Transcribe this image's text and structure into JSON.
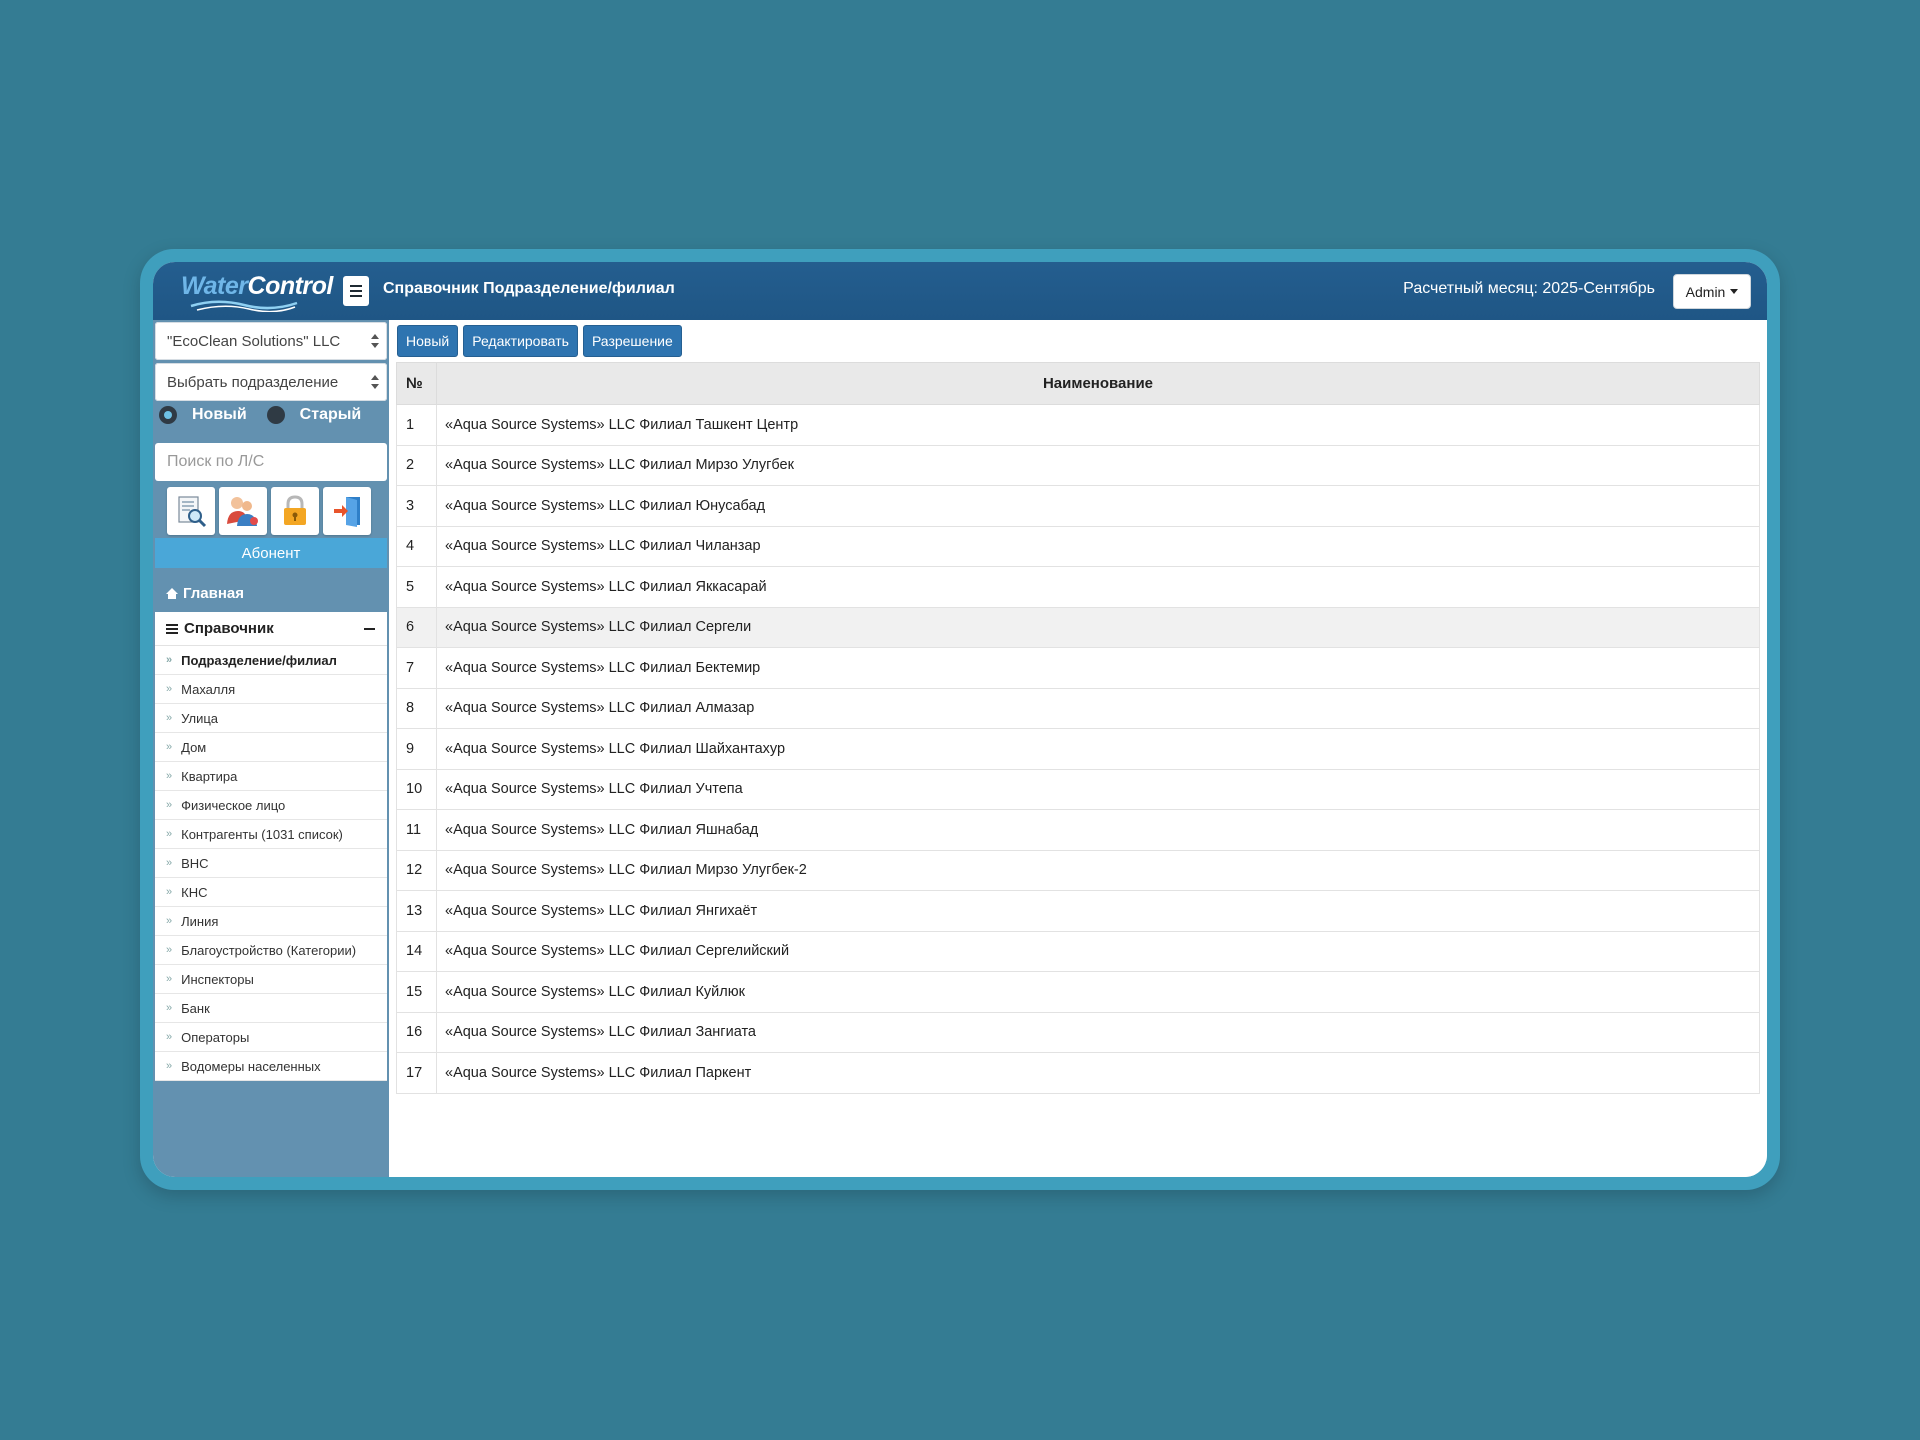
{
  "header": {
    "logo_part1": "Water",
    "logo_part2": "Control",
    "title": "Справочник Подразделение/филиал",
    "month_label": "Расчетный месяц: 2025-Сентябрь",
    "user_menu": "Admin"
  },
  "sidebar": {
    "company_select": "\"EcoClean Solutions\" LLC",
    "division_select": "Выбрать подразделение",
    "radio_new": "Новый",
    "radio_old": "Старый",
    "radio_selected": "Новый",
    "search_placeholder": "Поиск по Л/С",
    "tool_icons": [
      "document-search-icon",
      "users-icon",
      "lock-icon",
      "exit-door-icon"
    ],
    "abonent_label": "Абонент",
    "home_label": "Главная",
    "section_label": "Справочник",
    "items": [
      {
        "label": "Подразделение/филиал",
        "active": true
      },
      {
        "label": "Махалля"
      },
      {
        "label": "Улица"
      },
      {
        "label": "Дом"
      },
      {
        "label": "Квартира"
      },
      {
        "label": "Физическое лицо"
      },
      {
        "label": "Контрагенты (1031 список)"
      },
      {
        "label": "ВНС"
      },
      {
        "label": "КНС"
      },
      {
        "label": "Линия"
      },
      {
        "label": "Благоустройство (Категории)"
      },
      {
        "label": "Инспекторы"
      },
      {
        "label": "Банк"
      },
      {
        "label": "Операторы"
      },
      {
        "label": "Водомеры населенных"
      }
    ],
    "bullet": "»",
    "bottom_icons": [
      "chat-icon",
      "mail-icon"
    ]
  },
  "toolbar": {
    "new_label": "Новый",
    "edit_label": "Редактировать",
    "permission_label": "Разрешение"
  },
  "table": {
    "col_num": "№",
    "col_name": "Наименование",
    "highlighted_row": 6,
    "rows": [
      {
        "num": "1",
        "name": "«Aqua Source Systems» LLC Филиал Ташкент Центр"
      },
      {
        "num": "2",
        "name": "«Aqua Source Systems» LLC Филиал Мирзо Улугбек"
      },
      {
        "num": "3",
        "name": "«Aqua Source Systems» LLC Филиал Юнусабад"
      },
      {
        "num": "4",
        "name": "«Aqua Source Systems» LLC Филиал Чиланзар"
      },
      {
        "num": "5",
        "name": "«Aqua Source Systems» LLC Филиал Яккасарай"
      },
      {
        "num": "6",
        "name": "«Aqua Source Systems» LLC Филиал Сергели"
      },
      {
        "num": "7",
        "name": "«Aqua Source Systems» LLC Филиал Бектемир"
      },
      {
        "num": "8",
        "name": "«Aqua Source Systems» LLC Филиал Алмазар"
      },
      {
        "num": "9",
        "name": "«Aqua Source Systems» LLC Филиал Шайхантахур"
      },
      {
        "num": "10",
        "name": "«Aqua Source Systems» LLC Филиал Учтепа"
      },
      {
        "num": "11",
        "name": "«Aqua Source Systems» LLC Филиал Яшнабад"
      },
      {
        "num": "12",
        "name": "«Aqua Source Systems» LLC Филиал Мирзо Улугбек-2"
      },
      {
        "num": "13",
        "name": "«Aqua Source Systems» LLC Филиал Янгихаёт"
      },
      {
        "num": "14",
        "name": "«Aqua Source Systems» LLC Филиал Сергелийский"
      },
      {
        "num": "15",
        "name": "«Aqua Source Systems» LLC Филиал Куйлюк"
      },
      {
        "num": "16",
        "name": "«Aqua Source Systems» LLC Филиал Зангиата"
      },
      {
        "num": "17",
        "name": "«Aqua Source Systems» LLC Филиал Паркент"
      }
    ]
  },
  "colors": {
    "header": "#245e8f",
    "sidebar": "#6391b0",
    "button": "#2e74b0",
    "abonent": "#4aa7d8",
    "page_bg": "#347c93",
    "frame": "#3f9fbd"
  }
}
